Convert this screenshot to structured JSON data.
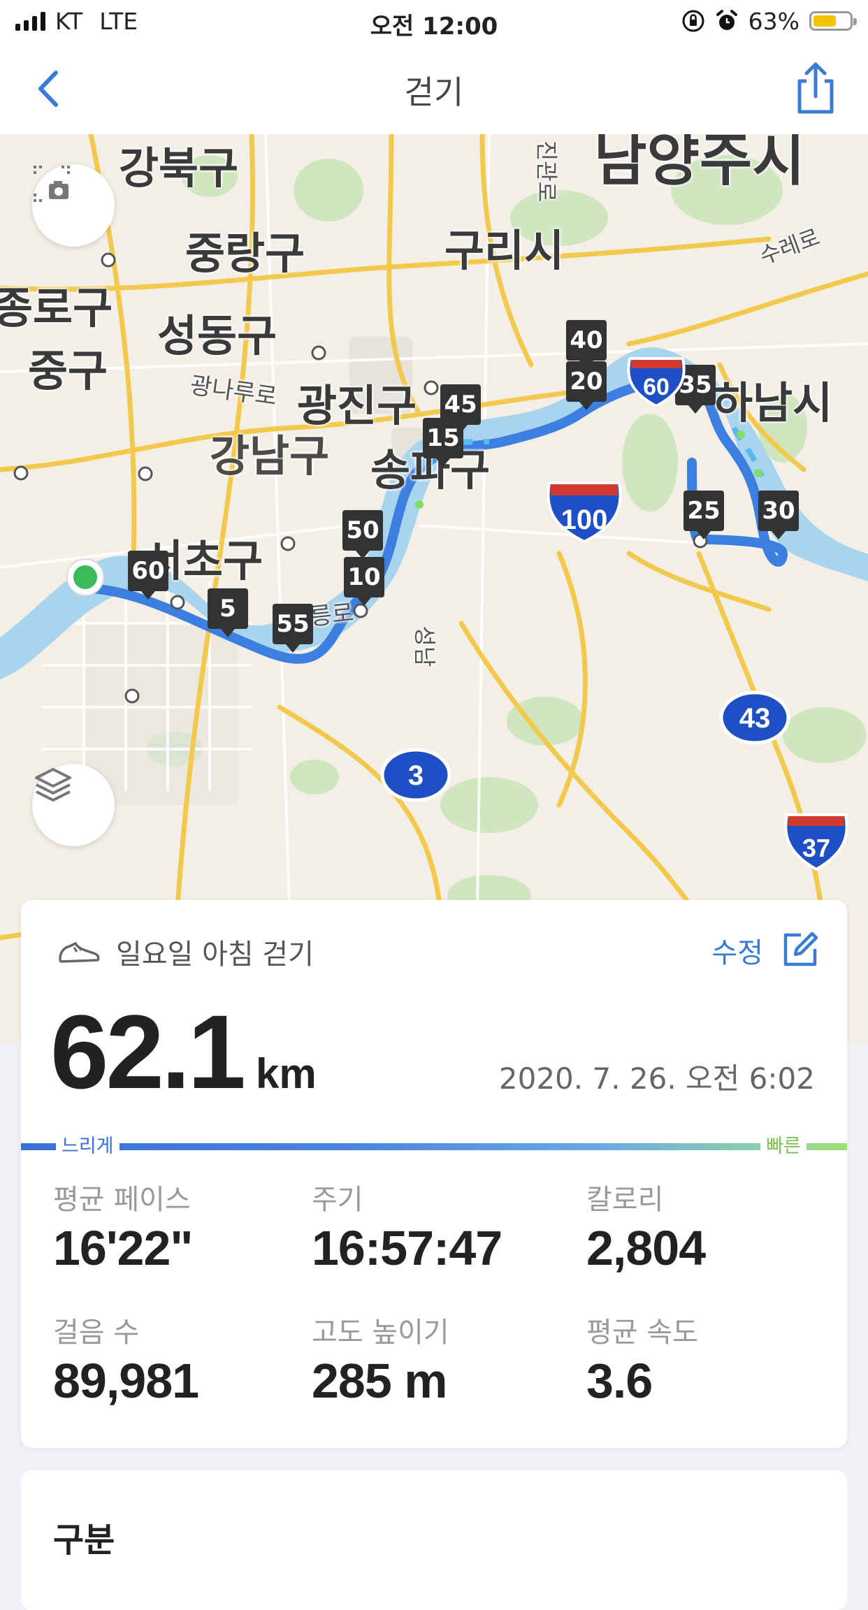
{
  "status_bar": {
    "carrier": "KT",
    "network": "LTE",
    "time": "오전 12:00",
    "battery": "63%",
    "battery_level": 0.63
  },
  "nav": {
    "title": "걷기",
    "back_icon": "chevron-left-icon",
    "share_icon": "share-icon"
  },
  "map": {
    "labels": {
      "gangbuk": "강북구",
      "namyangju": "남양주시",
      "jungnang": "중랑구",
      "guri": "구리시",
      "jongno": "종로구",
      "seongdong": "성동구",
      "junggu": "중구",
      "gwangnaru": "광나루로",
      "gwangjin": "광진구",
      "songpa": "송파구",
      "seocho": "서초구",
      "hanam": "하남시",
      "gangnam": "강남구",
      "heolleung": "헌릉로",
      "jingwan": "진관로",
      "sure": "수레로",
      "seongnam": "성남"
    },
    "km_markers": [
      "60",
      "5",
      "55",
      "50",
      "10",
      "45",
      "15",
      "40",
      "20",
      "35",
      "25",
      "30"
    ],
    "highway_shields": [
      "100",
      "60",
      "43",
      "3",
      "37"
    ],
    "route_color": "#3d7fe0"
  },
  "activity": {
    "icon": "shoe-icon",
    "name": "일요일 아침 걷기",
    "edit_label": "수정",
    "distance": "62.1",
    "distance_unit": "km",
    "date": "2020. 7. 26. 오전 6:02",
    "pace_slow_label": "느리게",
    "pace_fast_label": "빠른",
    "stats": {
      "avg_pace": {
        "label": "평균 페이스",
        "value": "16'22\""
      },
      "duration": {
        "label": "주기",
        "value": "16:57:47"
      },
      "calories": {
        "label": "칼로리",
        "value": "2,804"
      },
      "steps": {
        "label": "걸음 수",
        "value": "89,981"
      },
      "elevation": {
        "label": "고도 높이기",
        "value": "285 m"
      },
      "avg_speed": {
        "label": "평균 속도",
        "value": "3.6"
      }
    }
  },
  "splits": {
    "title": "구분"
  }
}
